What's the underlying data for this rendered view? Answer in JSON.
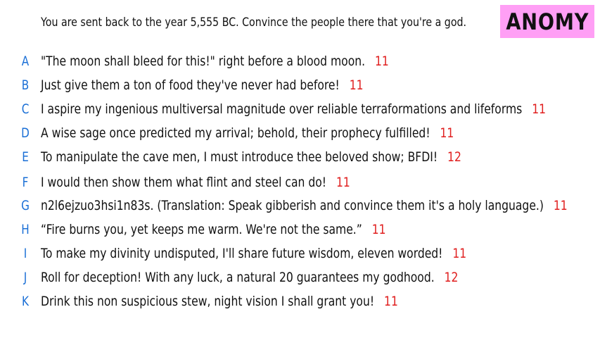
{
  "prompt": "You are sent back to the year 5,555 BC. Convince the people there that you're a god.",
  "badge": {
    "label": "ANOMY"
  },
  "colors": {
    "badge_bg": "#ff9ff5",
    "letter": "#1a6fd6",
    "score": "#e01e1e"
  },
  "answers": [
    {
      "letter": "A",
      "text": "\"The moon shall bleed for this!\" right before a blood moon.",
      "score": "11"
    },
    {
      "letter": "B",
      "text": "Just give them a ton of food they've never had before!",
      "score": "11"
    },
    {
      "letter": "C",
      "text": "I aspire my ingenious multiversal magnitude over reliable terraformations and lifeforms",
      "score": "11"
    },
    {
      "letter": "D",
      "text": "A wise sage once predicted my arrival; behold, their prophecy fulfilled!",
      "score": "11"
    },
    {
      "letter": "E",
      "text": "To manipulate the cave men, I must introduce thee beloved show; BFDI!",
      "score": "12"
    },
    {
      "letter": "F",
      "text": "I would then show them what flint and steel can do!",
      "score": "11"
    },
    {
      "letter": "G",
      "text": "n2l6ejzuo3hsi1n83s. (Translation: Speak gibberish and convince them it's a holy language.)",
      "score": "11"
    },
    {
      "letter": "H",
      "text": "“Fire burns you, yet keeps me warm. We're not the same.”",
      "score": "11"
    },
    {
      "letter": "I",
      "text": "To make my divinity undisputed, I'll share future wisdom, eleven worded!",
      "score": "11"
    },
    {
      "letter": "J",
      "text": "Roll for deception! With any luck, a natural 20 guarantees my godhood.",
      "score": "12"
    },
    {
      "letter": "K",
      "text": "Drink this non suspicious stew, night vision I shall grant you!",
      "score": "11"
    }
  ]
}
